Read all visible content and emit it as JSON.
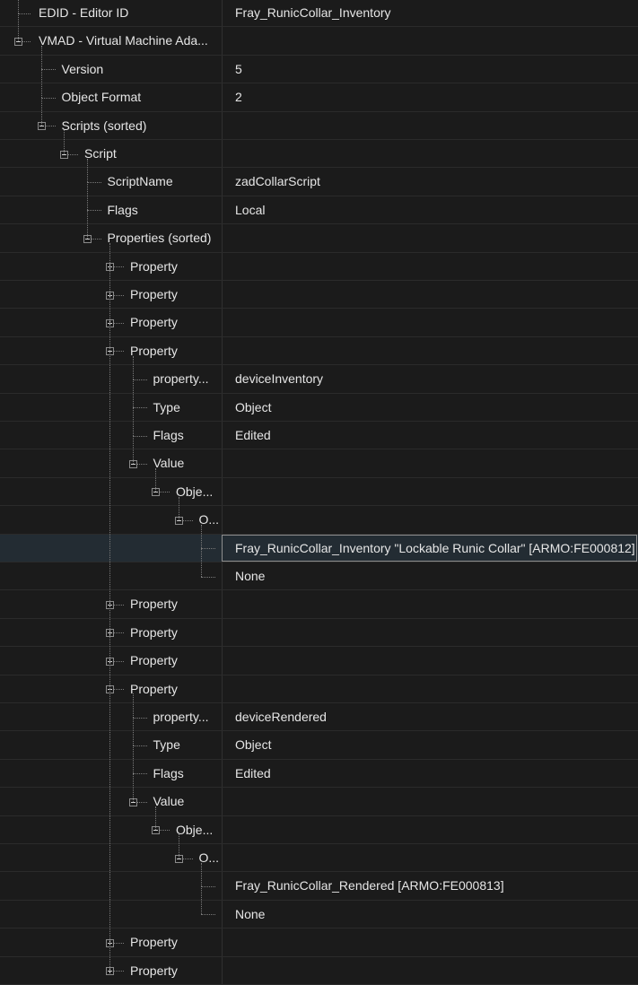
{
  "rows": [
    {
      "name": "EDID - Editor ID",
      "value": "Fray_RunicCollar_Inventory",
      "depth": 0,
      "toggle": null
    },
    {
      "name": "VMAD - Virtual Machine Ada...",
      "value": "",
      "depth": 0,
      "toggle": "collapse"
    },
    {
      "name": "Version",
      "value": "5",
      "depth": 1,
      "toggle": null
    },
    {
      "name": "Object Format",
      "value": "2",
      "depth": 1,
      "toggle": null
    },
    {
      "name": "Scripts (sorted)",
      "value": "",
      "depth": 1,
      "toggle": "collapse"
    },
    {
      "name": "Script",
      "value": "",
      "depth": 2,
      "toggle": "collapse"
    },
    {
      "name": "ScriptName",
      "value": "zadCollarScript",
      "depth": 3,
      "toggle": null
    },
    {
      "name": "Flags",
      "value": "Local",
      "depth": 3,
      "toggle": null
    },
    {
      "name": "Properties (sorted)",
      "value": "",
      "depth": 3,
      "toggle": "collapse"
    },
    {
      "name": "Property",
      "value": "",
      "depth": 4,
      "toggle": "expand"
    },
    {
      "name": "Property",
      "value": "",
      "depth": 4,
      "toggle": "expand"
    },
    {
      "name": "Property",
      "value": "",
      "depth": 4,
      "toggle": "expand"
    },
    {
      "name": "Property",
      "value": "",
      "depth": 4,
      "toggle": "collapse"
    },
    {
      "name": "property...",
      "value": "deviceInventory",
      "depth": 5,
      "toggle": null
    },
    {
      "name": "Type",
      "value": "Object",
      "depth": 5,
      "toggle": null
    },
    {
      "name": "Flags",
      "value": "Edited",
      "depth": 5,
      "toggle": null
    },
    {
      "name": "Value",
      "value": "",
      "depth": 5,
      "toggle": "collapse"
    },
    {
      "name": "Obje...",
      "value": "",
      "depth": 6,
      "toggle": "collapse"
    },
    {
      "name": "O...",
      "value": "",
      "depth": 7,
      "toggle": "collapse"
    },
    {
      "name": "",
      "value": "Fray_RunicCollar_Inventory \"Lockable Runic Collar\" [ARMO:FE000812]",
      "depth": 8,
      "toggle": null,
      "selected": true
    },
    {
      "name": "",
      "value": "None",
      "depth": 8,
      "toggle": null
    },
    {
      "name": "Property",
      "value": "",
      "depth": 4,
      "toggle": "expand"
    },
    {
      "name": "Property",
      "value": "",
      "depth": 4,
      "toggle": "expand"
    },
    {
      "name": "Property",
      "value": "",
      "depth": 4,
      "toggle": "expand"
    },
    {
      "name": "Property",
      "value": "",
      "depth": 4,
      "toggle": "collapse"
    },
    {
      "name": "property...",
      "value": "deviceRendered",
      "depth": 5,
      "toggle": null
    },
    {
      "name": "Type",
      "value": "Object",
      "depth": 5,
      "toggle": null
    },
    {
      "name": "Flags",
      "value": "Edited",
      "depth": 5,
      "toggle": null
    },
    {
      "name": "Value",
      "value": "",
      "depth": 5,
      "toggle": "collapse"
    },
    {
      "name": "Obje...",
      "value": "",
      "depth": 6,
      "toggle": "collapse"
    },
    {
      "name": "O...",
      "value": "",
      "depth": 7,
      "toggle": "collapse"
    },
    {
      "name": "",
      "value": "Fray_RunicCollar_Rendered [ARMO:FE000813]",
      "depth": 8,
      "toggle": null
    },
    {
      "name": "",
      "value": "None",
      "depth": 8,
      "toggle": null
    },
    {
      "name": "Property",
      "value": "",
      "depth": 4,
      "toggle": "expand"
    },
    {
      "name": "Property",
      "value": "",
      "depth": 4,
      "toggle": "expand"
    }
  ]
}
